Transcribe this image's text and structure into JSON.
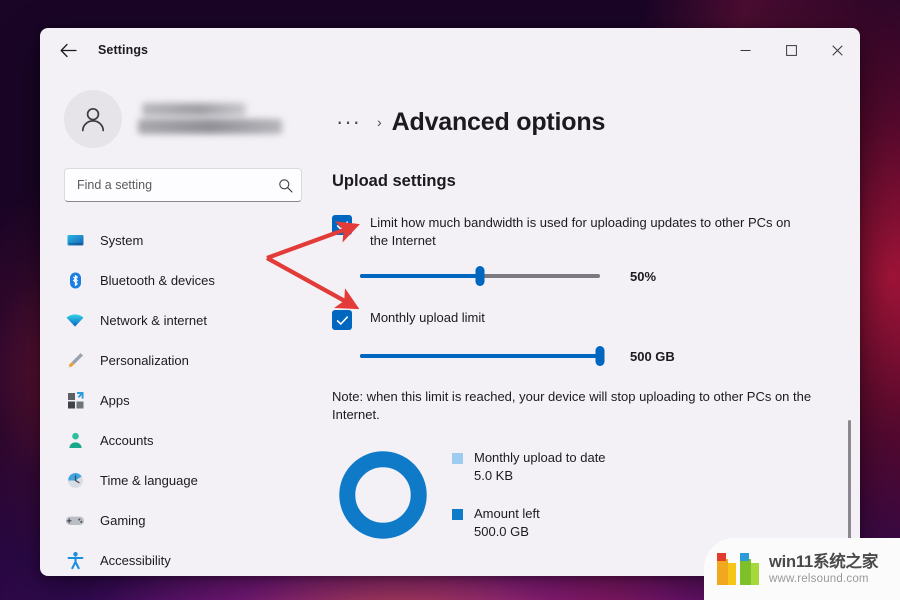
{
  "window": {
    "app_title": "Settings",
    "back_icon": "arrow-left-icon",
    "controls": {
      "minimize": "minimize-icon",
      "maximize": "maximize-icon",
      "close": "close-icon"
    }
  },
  "sidebar": {
    "account": {
      "avatar_icon": "person-avatar-icon",
      "name_redacted": true
    },
    "search": {
      "placeholder": "Find a setting",
      "value": "",
      "icon": "search-icon"
    },
    "items": [
      {
        "label": "System",
        "icon": "monitor-icon"
      },
      {
        "label": "Bluetooth & devices",
        "icon": "bluetooth-icon"
      },
      {
        "label": "Network & internet",
        "icon": "wifi-icon"
      },
      {
        "label": "Personalization",
        "icon": "paintbrush-icon"
      },
      {
        "label": "Apps",
        "icon": "apps-grid-icon"
      },
      {
        "label": "Accounts",
        "icon": "person-icon"
      },
      {
        "label": "Time & language",
        "icon": "clock-icon"
      },
      {
        "label": "Gaming",
        "icon": "gamepad-icon"
      },
      {
        "label": "Accessibility",
        "icon": "accessibility-icon"
      }
    ]
  },
  "main": {
    "breadcrumb": {
      "ellipsis": "···",
      "separator": "›"
    },
    "page_title": "Advanced options",
    "section_title": "Upload settings",
    "settings": [
      {
        "label": "Limit how much bandwidth is used for uploading updates to other PCs on the Internet",
        "checked": true,
        "slider": {
          "value_label": "50%",
          "percent": 50
        }
      },
      {
        "label": "Monthly upload limit",
        "checked": true,
        "slider": {
          "value_label": "500 GB",
          "percent": 100
        }
      }
    ],
    "note": "Note: when this limit is reached, your device will stop uploading to other PCs on the Internet."
  },
  "chart_data": {
    "type": "pie",
    "title": "",
    "subtype": "donut",
    "legend_position": "right",
    "labels": [
      "Monthly upload to date",
      "Amount left"
    ],
    "value_labels": [
      "5.0 KB",
      "500.0 GB"
    ],
    "values": [
      5e-06,
      500
    ],
    "unit": "GB",
    "colors": [
      "#9ecbf0",
      "#0f7ac8"
    ],
    "percentages": [
      1e-06,
      99.999999
    ]
  },
  "theme": {
    "accent": "#0067c0",
    "donut_blue": "#0f7ac8",
    "legend_light_blue": "#9ecbf0",
    "annotation_red": "#e23b38",
    "window_bg": "#f3f0f6"
  },
  "annotations": {
    "arrows": [
      {
        "name": "arrow-to-bandwidth-checkbox"
      },
      {
        "name": "arrow-to-monthly-limit-checkbox"
      }
    ]
  },
  "watermark": {
    "title": "win11系统之家",
    "url": "www.relsound.com",
    "logo_icon": "win11-blocks-logo"
  }
}
